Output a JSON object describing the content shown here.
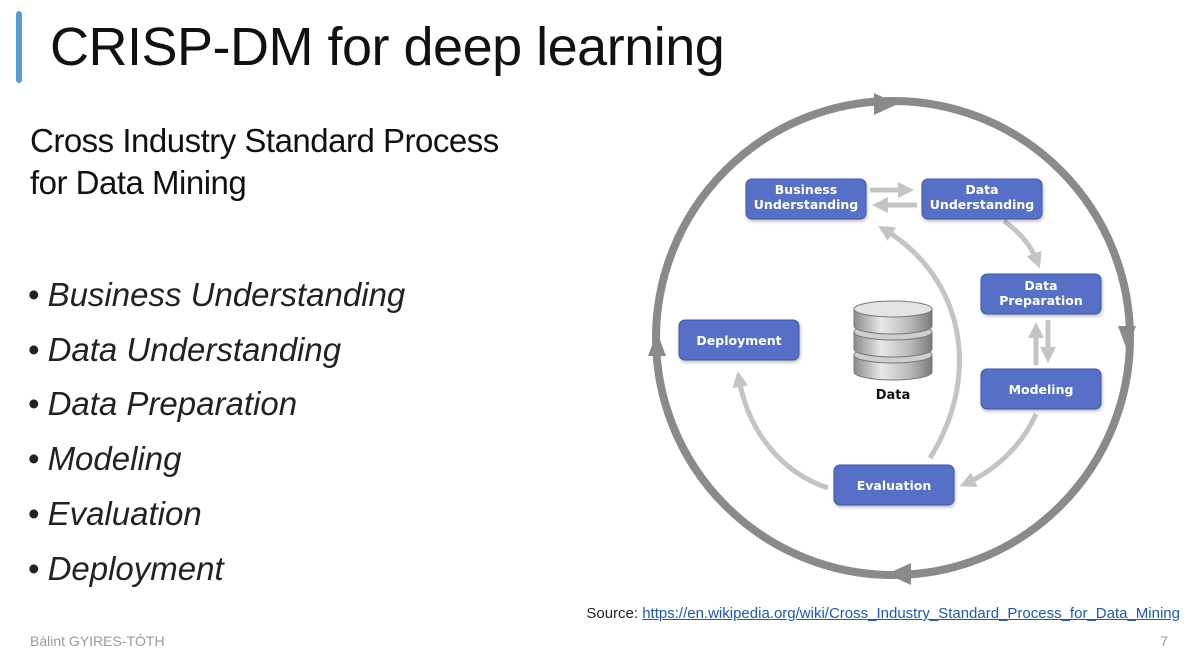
{
  "slide": {
    "title": "CRISP-DM for deep learning",
    "subtitle_line1": "Cross Industry Standard Process",
    "subtitle_line2": "for Data Mining",
    "bullet_char": "•",
    "bullets": [
      "Business Understanding",
      "Data Understanding",
      "Data Preparation",
      "Modeling",
      "Evaluation",
      "Deployment"
    ],
    "source_prefix": "Source: ",
    "source_link": "https://en.wikipedia.org/wiki/Cross_Industry_Standard_Process_for_Data_Mining",
    "author": "Bálint GYIRES-TÓTH",
    "page_number": "7"
  },
  "diagram": {
    "boxes": {
      "business": [
        "Business",
        "Understanding"
      ],
      "data_understanding": [
        "Data",
        "Understanding"
      ],
      "data_preparation": [
        "Data",
        "Preparation"
      ],
      "modeling": "Modeling",
      "evaluation": "Evaluation",
      "deployment": "Deployment"
    },
    "data_label": "Data"
  },
  "colors": {
    "accent": "#5b9bd5",
    "box_fill": "#5470c6",
    "ring": "#8a8a8a",
    "arrow": "#c4c4c4",
    "link": "#1a56c9"
  }
}
